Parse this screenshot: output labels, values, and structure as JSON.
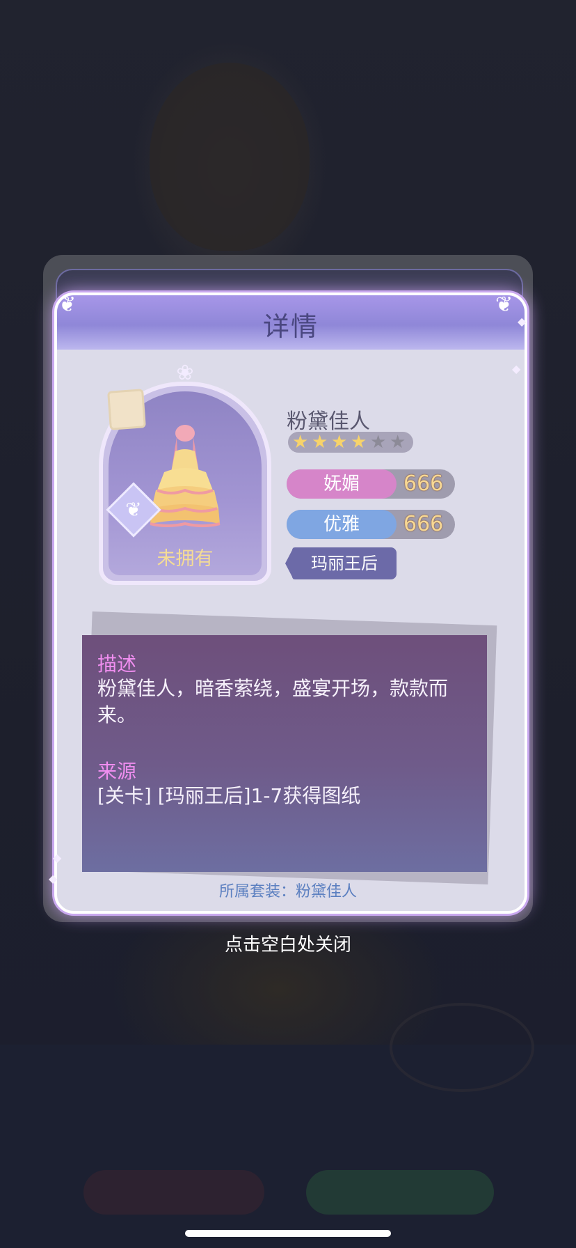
{
  "dialog": {
    "title": "详情",
    "item": {
      "name": "粉黛佳人",
      "status": "未拥有",
      "stars_filled": 4,
      "stars_total": 6,
      "stats": [
        {
          "label": "妩媚",
          "value": "666",
          "color": "#d685c9"
        },
        {
          "label": "优雅",
          "value": "666",
          "color": "#7fa6e2"
        }
      ],
      "tag": "玛丽王后"
    },
    "description": {
      "heading": "描述",
      "text": "粉黛佳人，暗香萦绕，盛宴开场，款款而来。"
    },
    "source": {
      "heading": "来源",
      "text": "[关卡] [玛丽王后]1-7获得图纸"
    },
    "set": "所属套装：粉黛佳人"
  },
  "close_hint": "点击空白处关闭",
  "colors": {
    "accent_purple": "#8f87d8",
    "stat_value": "#f7d894",
    "heading_pink": "#f08ef0"
  }
}
